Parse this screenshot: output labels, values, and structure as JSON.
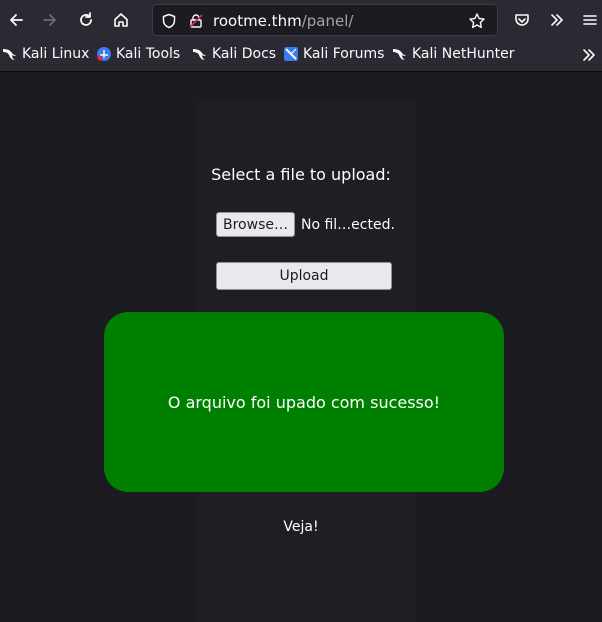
{
  "browser": {
    "url_host": "rootme.thm",
    "url_path": "/panel/",
    "bookmarks": [
      {
        "label": "Kali Linux",
        "icon": "kali-dragon-icon"
      },
      {
        "label": "Kali Tools",
        "icon": "kali-tools-icon"
      },
      {
        "label": "Kali Docs",
        "icon": "kali-dragon-icon"
      },
      {
        "label": "Kali Forums",
        "icon": "kali-forums-icon"
      },
      {
        "label": "Kali NetHunter",
        "icon": "kali-dragon-icon"
      }
    ]
  },
  "page": {
    "upload_title": "Select a file to upload:",
    "browse_label": "Browse…",
    "file_status": "No fil…ected.",
    "upload_label": "Upload",
    "success_message": "O arquivo foi upado com sucesso!",
    "veja_label": "Veja!"
  },
  "colors": {
    "success_green": "#008000",
    "page_bg": "#1c1b22",
    "chrome_bg": "#2b2a33"
  }
}
